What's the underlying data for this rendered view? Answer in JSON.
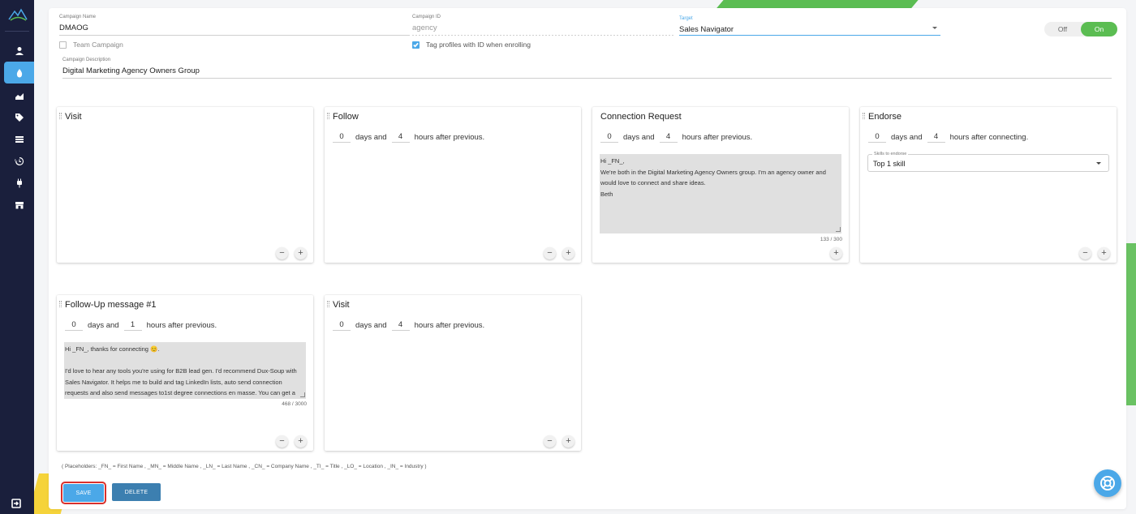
{
  "nav": {
    "items": [
      {
        "icon": "person-icon"
      },
      {
        "icon": "drop-icon",
        "active": true
      },
      {
        "icon": "chart-icon"
      },
      {
        "icon": "tags-icon"
      },
      {
        "icon": "layers-icon"
      },
      {
        "icon": "history-icon"
      },
      {
        "icon": "plug-icon"
      },
      {
        "icon": "store-icon"
      }
    ],
    "exit_icon": "logout-icon"
  },
  "campaign": {
    "name_label": "Campaign Name",
    "name_value": "DMAOG",
    "id_label": "Campaign ID",
    "id_value": "agency",
    "target_label": "Target",
    "target_value": "Sales Navigator",
    "team_campaign_label": "Team Campaign",
    "team_campaign_checked": false,
    "tag_profiles_label": "Tag profiles with ID when enrolling",
    "tag_profiles_checked": true,
    "description_label": "Campaign Description",
    "description_value": "Digital Marketing Agency Owners Group"
  },
  "toggle": {
    "off_label": "Off",
    "on_label": "On",
    "state": "On"
  },
  "cards": [
    {
      "title": "Visit"
    },
    {
      "title": "Follow",
      "days": "0",
      "days_label": "days and",
      "hours": "4",
      "hours_label": "hours after previous."
    },
    {
      "title": "Connection Request",
      "days": "0",
      "days_label": "days and",
      "hours": "4",
      "hours_label": "hours after previous.",
      "message": "Hi _FN_,\nWe're both in the Digital Marketing Agency Owners group. I'm an agency owner and would love to connect and share ideas.\nBeth",
      "counter": "133 / 300"
    },
    {
      "title": "Endorse",
      "days": "0",
      "days_label": "days and",
      "hours": "4",
      "hours_label": "hours after connecting.",
      "select_label": "Skills to endorse",
      "select_value": "Top 1 skill"
    },
    {
      "title": "Follow-Up message #1",
      "days": "0",
      "days_label": "days and",
      "hours": "1",
      "hours_label": "hours after previous.",
      "message": "Hi _FN_, thanks for connecting 😊.\n\nI'd love to hear any tools you're using for B2B lead gen. I'd recommend Dux-Soup with Sales Navigator. It helps me to build and tag LinkedIn lists, auto send connection requests and also send messages to1st degree connections en masse. You can get a",
      "counter": "468 / 3000"
    },
    {
      "title": "Visit",
      "days": "0",
      "days_label": "days and",
      "hours": "4",
      "hours_label": "hours after previous."
    }
  ],
  "placeholders_text": "( Placeholders: _FN_ = First Name , _MN_ = Middle Name , _LN_ = Last Name , _CN_ = Company Name , _TI_ = Title , _LO_ = Location , _IN_ = Industry )",
  "buttons": {
    "save": "SAVE",
    "delete": "DELETE"
  },
  "colors": {
    "sidebar": "#1a1f3c",
    "accent": "#4ba8e8",
    "toggle_on": "#5bbd52",
    "delete": "#3c7fb0",
    "highlight": "#d9302c"
  }
}
